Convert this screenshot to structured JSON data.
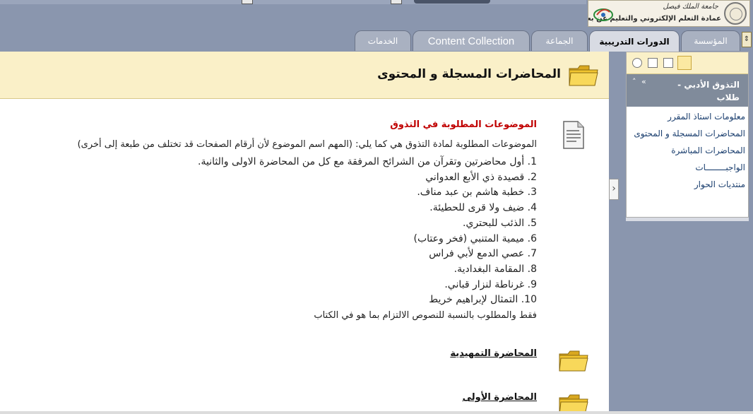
{
  "header": {
    "logo_line1": "جامعة الملك فيصل",
    "logo_line2": "عمادة التعلم الإلكتروني والتعليم عن بعد"
  },
  "tabs": [
    {
      "label": "المؤسسة",
      "active": false
    },
    {
      "label": "الدورات التدريبية",
      "active": true
    },
    {
      "label": "الجماعة",
      "active": false
    },
    {
      "label": "Content Collection",
      "active": false
    },
    {
      "label": "الخدمات",
      "active": false
    }
  ],
  "page": {
    "title": "المحاضرات المسجلة و المحتوى",
    "item_heading": "الموضوعات المطلوبة في التذوق",
    "intro": "الموضوعات المطلوبة لمادة التذوق هي كما يلي: (المهم اسم الموضوع لأن أرقام الصفحات قد تختلف من طبعة إلى أخرى)",
    "topics": [
      {
        "num": "1.",
        "text": "أول محاضرتين وتقرآن من الشرائح المرفقة مع كل من المحاضرة الاولى والثانية."
      },
      {
        "num": "2.",
        "text": "قصيدة ذي الأبع العدواني"
      },
      {
        "num": "3.",
        "text": "خطبة هاشم بن عبد مناف."
      },
      {
        "num": "4.",
        "text": "ضيف ولا قرى للحطيئة."
      },
      {
        "num": "5.",
        "text": "الذئب للبحتري."
      },
      {
        "num": "6.",
        "text": "ميمية المتنبي (فخر وعتاب)"
      },
      {
        "num": "7.",
        "text": "عصي الدمع لأبي فراس"
      },
      {
        "num": "8.",
        "text": "المقامة البغدادية."
      },
      {
        "num": "9.",
        "text": "غرناطة لنزار قباني."
      },
      {
        "num": "10.",
        "text": "التمثال لإبراهيم خريط"
      }
    ],
    "note": "فقط والمطلوب بالنسبة للنصوص الالتزام بما هو في الكتاب",
    "folders": [
      "المحاضرة التمهيدية",
      "المحاضرة الأولى"
    ]
  },
  "sidebar": {
    "course_title": "التذوق الأدبي - طلاب",
    "course_chevrons": "» ˄",
    "items": [
      "معلومات استاذ المقرر",
      "المحاضرات المسجلة و المحتوى",
      "المحاضرات المباشرة",
      "الواجبــــــــات",
      "منتديات الحوار"
    ]
  },
  "icons": {
    "folder": "folder-icon",
    "document": "document-icon",
    "collapse": "chevron-right-icon"
  },
  "colors": {
    "header_bg": "#8a96ae",
    "title_bar_bg": "#faf0c8",
    "heading_red": "#c00000",
    "link_blue": "#1a3e6e",
    "folder_yellow": "#f2c530"
  }
}
